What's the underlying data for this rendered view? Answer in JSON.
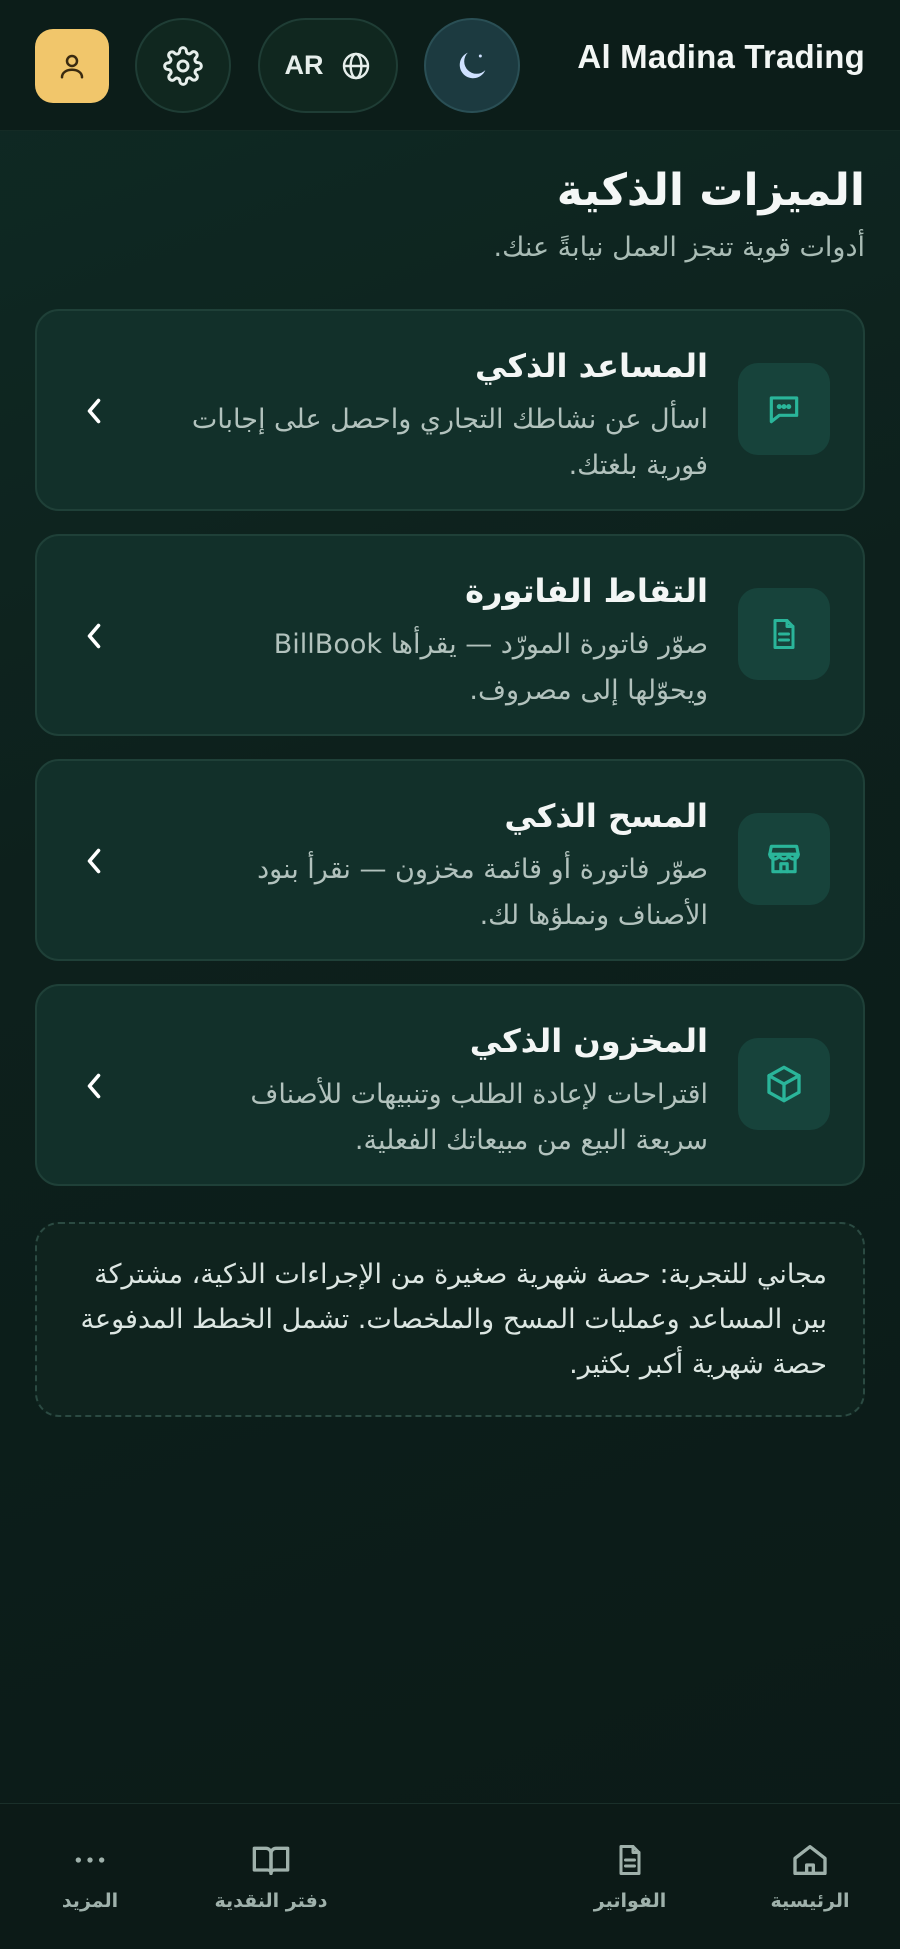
{
  "header": {
    "brand": "Al Madina Trading",
    "language_label": "AR",
    "icons": {
      "account": "user-icon",
      "settings": "gear-icon",
      "language": "globe-icon",
      "theme": "moon-icon"
    },
    "colors": {
      "account_bg": "#f1c66b",
      "accent": "#2ab59a"
    }
  },
  "page": {
    "title": "الميزات الذكية",
    "subtitle": "أدوات قوية تنجز العمل نيابةً عنك."
  },
  "features": [
    {
      "title": "المساعد الذكي",
      "description": "اسأل عن نشاطك التجاري واحصل على إجابات فورية بلغتك.",
      "icon": "chat-bubble-icon"
    },
    {
      "title": "التقاط الفاتورة",
      "description": "صوّر فاتورة المورّد — يقرأها BillBook ويحوّلها إلى مصروف.",
      "icon": "document-icon"
    },
    {
      "title": "المسح الذكي",
      "description": "صوّر فاتورة أو قائمة مخزون — نقرأ بنود الأصناف ونملؤها لك.",
      "icon": "store-icon"
    },
    {
      "title": "المخزون الذكي",
      "description": "اقتراحات لإعادة الطلب وتنبيهات للأصناف سريعة البيع من مبيعاتك الفعلية.",
      "icon": "box-icon"
    }
  ],
  "note": {
    "text": "مجاني للتجربة: حصة شهرية صغيرة من الإجراءات الذكية، مشتركة بين المساعد وعمليات المسح والملخصات. تشمل الخطط المدفوعة حصة شهرية أكبر بكثير."
  },
  "bottom_nav": [
    {
      "label": "الرئيسية",
      "icon": "home-icon"
    },
    {
      "label": "الفواتير",
      "icon": "invoice-icon"
    },
    {
      "label": "دفتر النقدية",
      "icon": "book-icon"
    },
    {
      "label": "المزيد",
      "icon": "more-dots-icon"
    }
  ]
}
